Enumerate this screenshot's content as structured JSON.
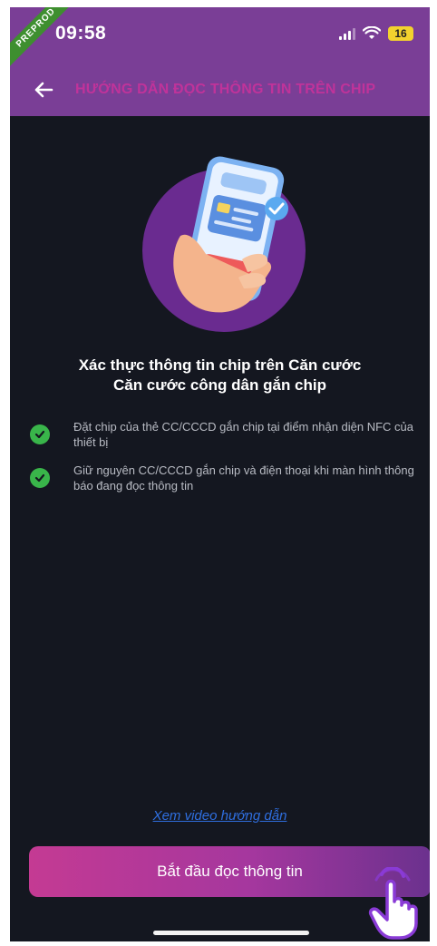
{
  "status_bar": {
    "time": "09:58",
    "badge": "PREPROD",
    "battery": "16"
  },
  "app_bar": {
    "back_icon": "arrow-left-icon",
    "title": "HƯỚNG DẪN ĐỌC THÔNG TIN TRÊN CHIP"
  },
  "illustration": {
    "icon": "hand-holding-phone-icon"
  },
  "heading": {
    "line1": "Xác thực thông tin chip trên Căn cước",
    "line2": "Căn cước công dân gắn chip"
  },
  "steps": [
    {
      "icon": "check-icon",
      "text": "Đặt chip của thẻ CC/CCCD gắn chip tại điểm nhận diện NFC của thiết bị"
    },
    {
      "icon": "check-icon",
      "text": "Giữ nguyên CC/CCCD gắn chip và điện thoại khi màn hình thông báo đang đọc thông tin"
    }
  ],
  "video_link": "Xem video hướng dẫn",
  "primary_button": "Bắt đầu đọc thông tin",
  "colors": {
    "header_bg": "#7a3e96",
    "title": "#c0339a",
    "background": "#141720",
    "check": "#39b54a",
    "link": "#2f6fe0",
    "button_start": "#c43a93",
    "button_end": "#6b318e"
  }
}
